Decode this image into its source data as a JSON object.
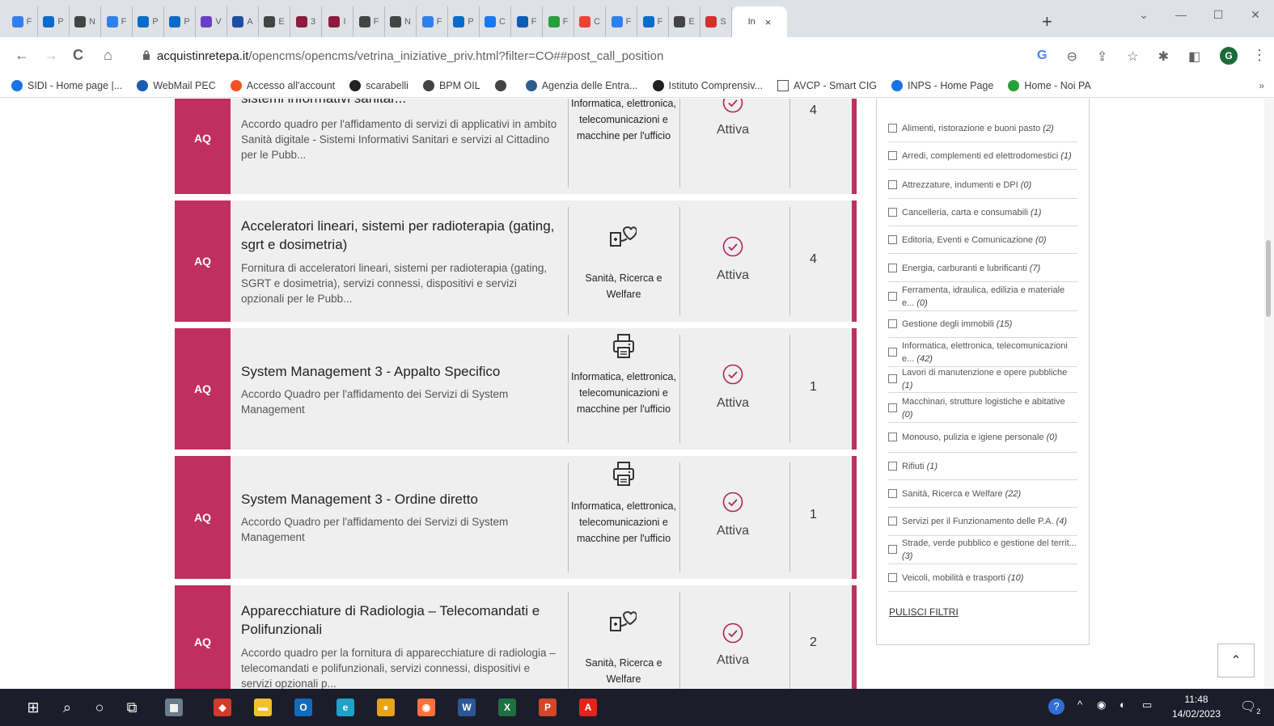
{
  "browser": {
    "tabs": [
      {
        "label": "F",
        "color": "#2f80ed"
      },
      {
        "label": "P",
        "color": "#0b6bcb"
      },
      {
        "label": "N",
        "color": "#444444"
      },
      {
        "label": "F",
        "color": "#2f80ed"
      },
      {
        "label": "P",
        "color": "#0b6bcb"
      },
      {
        "label": "P",
        "color": "#0b6bcb"
      },
      {
        "label": "V",
        "color": "#6a3fc8"
      },
      {
        "label": "A",
        "color": "#1e4fa0"
      },
      {
        "label": "E",
        "color": "#444444"
      },
      {
        "label": "3",
        "color": "#8b1b3f"
      },
      {
        "label": "I",
        "color": "#8b1b3f"
      },
      {
        "label": "F",
        "color": "#444444"
      },
      {
        "label": "N",
        "color": "#444444"
      },
      {
        "label": "F",
        "color": "#2f80ed"
      },
      {
        "label": "P",
        "color": "#0b6bcb"
      },
      {
        "label": "C",
        "color": "#1877f2"
      },
      {
        "label": "F",
        "color": "#0b5db3"
      },
      {
        "label": "F",
        "color": "#2a9d3c"
      },
      {
        "label": "C",
        "color": "#ea4335"
      },
      {
        "label": "F",
        "color": "#2f80ed"
      },
      {
        "label": "F",
        "color": "#0b6bcb"
      },
      {
        "label": "E",
        "color": "#444444"
      },
      {
        "label": "S",
        "color": "#d32f2f"
      }
    ],
    "active_tab": {
      "label": "In",
      "close": "×"
    },
    "new_tab": "+",
    "window_controls": {
      "dropdown": "⌄",
      "minimize": "—",
      "maximize": "☐",
      "close": "✕"
    },
    "nav": {
      "back": "←",
      "forward": "→",
      "reload": "C",
      "home": "⌂"
    },
    "url_host": "acquistinretepa.it",
    "url_path": "/opencms/opencms/vetrina_iniziative_priv.html?filter=CO##post_call_position",
    "omni_icons": {
      "google": "G",
      "zoom": "⊖",
      "share": "⇪",
      "star": "☆",
      "extensions": "✱",
      "sidepanel": "◧",
      "menu": "⋮"
    },
    "profile_initial": "G",
    "bookmarks": [
      {
        "label": "SIDI - Home page |...",
        "color": "#1a73e8"
      },
      {
        "label": "WebMail PEC",
        "color": "#1a5bb5"
      },
      {
        "label": "Accesso all'account",
        "color": "#f25022"
      },
      {
        "label": "scarabelli",
        "color": "#222222"
      },
      {
        "label": "BPM OIL",
        "color": "#444444"
      },
      {
        "label": "",
        "color": "#444444"
      },
      {
        "label": "Agenzia delle Entra...",
        "color": "#2f5e8e"
      },
      {
        "label": "Istituto Comprensiv...",
        "color": "#222222"
      },
      {
        "label": "AVCP - Smart CIG",
        "color": "#ffffff"
      },
      {
        "label": "INPS - Home Page",
        "color": "#1a73e8"
      },
      {
        "label": "Home - Noi PA",
        "color": "#2a9d3c"
      }
    ],
    "bookmarks_more": "»"
  },
  "cards": [
    {
      "badge": "AQ",
      "title": "sistemi informativi sanitar...",
      "description": "Accordo quadro per l'affidamento di servizi di applicativi in ambito Sanità digitale - Sistemi Informativi Sanitari e servizi al Cittadino per le Pubb...",
      "category": "Informatica, elettronica, telecomunicazioni e macchine per l'ufficio",
      "category_icon": "none",
      "status": "Attiva",
      "count": "4"
    },
    {
      "badge": "AQ",
      "title": "Acceleratori lineari, sistemi per radioterapia (gating, sgrt e dosimetria)",
      "description": "Fornitura di acceleratori lineari, sistemi per radioterapia (gating, SGRT e dosimetria), servizi connessi, dispositivi e servizi opzionali per le Pubb...",
      "category": "Sanità, Ricerca e Welfare",
      "category_icon": "health",
      "status": "Attiva",
      "count": "4"
    },
    {
      "badge": "AQ",
      "title": "System Management 3 - Appalto Specifico",
      "description": "Accordo Quadro per l'affidamento dei Servizi di System Management",
      "category": "Informatica, elettronica, telecomunicazioni e macchine per l'ufficio",
      "category_icon": "printer",
      "status": "Attiva",
      "count": "1"
    },
    {
      "badge": "AQ",
      "title": "System Management 3 - Ordine diretto",
      "description": "Accordo Quadro per l'affidamento dei Servizi di System Management",
      "category": "Informatica, elettronica, telecomunicazioni e macchine per l'ufficio",
      "category_icon": "printer",
      "status": "Attiva",
      "count": "1"
    },
    {
      "badge": "AQ",
      "title": "Apparecchiature di Radiologia – Telecomandati e Polifunzionali",
      "description": "Accordo quadro per la fornitura di apparecchiature di radiologia – telecomandati e polifunzionali, servizi connessi, dispositivi e servizi opzionali p...",
      "category": "Sanità, Ricerca e Welfare",
      "category_icon": "health",
      "status": "Attiva",
      "count": "2"
    }
  ],
  "filters": [
    {
      "label": "Alimenti, ristorazione e buoni pasto",
      "count": "(2)"
    },
    {
      "label": "Arredi, complementi ed elettrodomestici",
      "count": "(1)"
    },
    {
      "label": "Attrezzature, indumenti e DPI",
      "count": "(0)"
    },
    {
      "label": "Cancelleria, carta e consumabili",
      "count": "(1)"
    },
    {
      "label": "Editoria, Eventi e Comunicazione",
      "count": "(0)"
    },
    {
      "label": "Energia, carburanti e lubrificanti",
      "count": "(7)"
    },
    {
      "label": "Ferramenta, idraulica, edilizia e materiale e...",
      "count": "(0)"
    },
    {
      "label": "Gestione degli immobili",
      "count": "(15)"
    },
    {
      "label": "Informatica, elettronica, telecomunicazioni e...",
      "count": "(42)"
    },
    {
      "label": "Lavori di manutenzione e opere pubbliche",
      "count": "(1)"
    },
    {
      "label": "Macchinari, strutture logistiche e abitative",
      "count": "(0)"
    },
    {
      "label": "Monouso, pulizia e igiene personale",
      "count": "(0)"
    },
    {
      "label": "Rifiuti",
      "count": "(1)"
    },
    {
      "label": "Sanità, Ricerca e Welfare",
      "count": "(22)"
    },
    {
      "label": "Servizi per il Funzionamento delle P.A.",
      "count": "(4)"
    },
    {
      "label": "Strade, verde pubblico e gestione del territ...",
      "count": "(3)"
    },
    {
      "label": "Veicoli, mobilità e trasporti",
      "count": "(10)"
    }
  ],
  "clear_filters": "PULISCI FILTRI",
  "scroll_top": "⌃",
  "taskbar": {
    "apps": [
      {
        "name": "start",
        "glyph": "⊞",
        "color": "#ffffff"
      },
      {
        "name": "search",
        "glyph": "⌕",
        "color": "#ffffff"
      },
      {
        "name": "cortana",
        "glyph": "○",
        "color": "#ffffff"
      },
      {
        "name": "task-view",
        "glyph": "⧉",
        "color": "#ffffff"
      },
      {
        "name": "calculator",
        "glyph": "▦",
        "color": "#6b7d8c"
      },
      {
        "name": "app-red",
        "glyph": "◆",
        "color": "#d23b2b"
      },
      {
        "name": "file-explorer",
        "glyph": "▬",
        "color": "#f2c12e"
      },
      {
        "name": "outlook",
        "glyph": "O",
        "color": "#0f6cbd"
      },
      {
        "name": "edge",
        "glyph": "e",
        "color": "#1fa1c9"
      },
      {
        "name": "chrome",
        "glyph": "●",
        "color": "#e8a317"
      },
      {
        "name": "firefox",
        "glyph": "◉",
        "color": "#ff7139"
      },
      {
        "name": "word",
        "glyph": "W",
        "color": "#2b5797"
      },
      {
        "name": "excel",
        "glyph": "X",
        "color": "#1d7044"
      },
      {
        "name": "powerpoint",
        "glyph": "P",
        "color": "#d24726"
      },
      {
        "name": "acrobat",
        "glyph": "A",
        "color": "#e1251b"
      }
    ],
    "tray": {
      "help": "?",
      "chevron": "^",
      "notifications": "2"
    },
    "time": "11:48",
    "date": "14/02/2023"
  }
}
